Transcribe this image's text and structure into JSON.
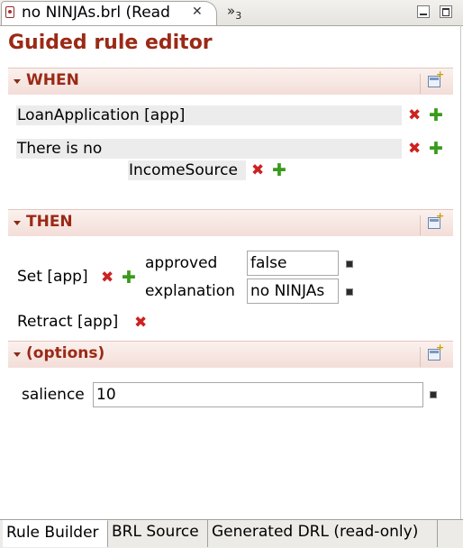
{
  "editor_tab": {
    "title": "no NINJAs.brl (Read",
    "close_glyph": "✕",
    "overflow_label": "»",
    "overflow_count": "3"
  },
  "page_title": "Guided rule editor",
  "when": {
    "label": "WHEN",
    "conditions": [
      {
        "text": "LoanApplication [app]"
      },
      {
        "text": "There is no",
        "nested": "IncomeSource"
      }
    ]
  },
  "then": {
    "label": "THEN",
    "set_action": {
      "label": "Set [app]",
      "fields": [
        {
          "name": "approved",
          "value": "false"
        },
        {
          "name": "explanation",
          "value": "no NINJAs"
        }
      ]
    },
    "retract_action": {
      "label": "Retract [app]"
    }
  },
  "options": {
    "label": "(options)",
    "attributes": [
      {
        "name": "salience",
        "value": "10"
      }
    ]
  },
  "icons": {
    "delete": "✖",
    "add": "✚"
  },
  "bottom_tabs": [
    {
      "label": "Rule Builder",
      "active": true
    },
    {
      "label": "BRL Source",
      "active": false
    },
    {
      "label": "Generated DRL (read-only)",
      "active": false
    }
  ],
  "colors": {
    "accent": "#9a2a16",
    "delete": "#cc2222",
    "add": "#3a9a1c"
  }
}
